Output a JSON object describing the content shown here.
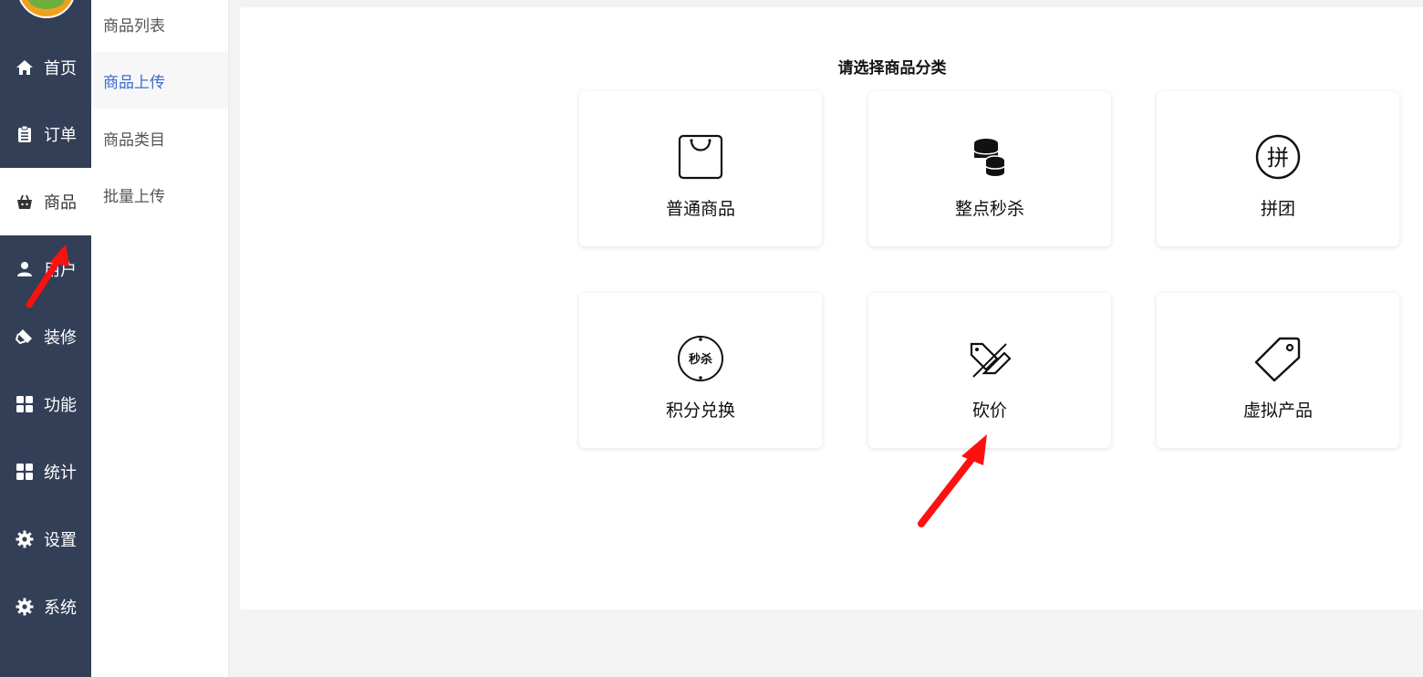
{
  "nav": {
    "items": [
      {
        "label": "首页",
        "icon": "home-icon"
      },
      {
        "label": "订单",
        "icon": "clipboard-icon"
      },
      {
        "label": "商品",
        "icon": "basket-icon"
      },
      {
        "label": "用户",
        "icon": "user-icon"
      },
      {
        "label": "装修",
        "icon": "paint-roller-icon"
      },
      {
        "label": "功能",
        "icon": "grid-icon"
      },
      {
        "label": "统计",
        "icon": "grid-icon"
      },
      {
        "label": "设置",
        "icon": "gear-icon"
      },
      {
        "label": "系统",
        "icon": "gear-icon"
      }
    ],
    "active": "商品"
  },
  "subnav": {
    "items": [
      {
        "label": "商品列表"
      },
      {
        "label": "商品上传"
      },
      {
        "label": "商品类目"
      },
      {
        "label": "批量上传"
      }
    ],
    "active": "商品上传"
  },
  "main": {
    "title": "请选择商品分类",
    "cards": [
      {
        "label": "普通商品",
        "icon": "shopping-bag-icon"
      },
      {
        "label": "整点秒杀",
        "icon": "coins-stack-icon"
      },
      {
        "label": "拼团",
        "icon": "group-buy-icon",
        "glyph": "拼"
      },
      {
        "label": "积分兑换",
        "icon": "seckill-badge-icon",
        "glyph": "秒杀"
      },
      {
        "label": "砍价",
        "icon": "price-cut-tag-icon"
      },
      {
        "label": "虚拟产品",
        "icon": "tag-icon"
      }
    ]
  },
  "colors": {
    "nav_bg": "#323f57",
    "active_sub": "#3a6bd1",
    "arrow": "#ff1010"
  }
}
